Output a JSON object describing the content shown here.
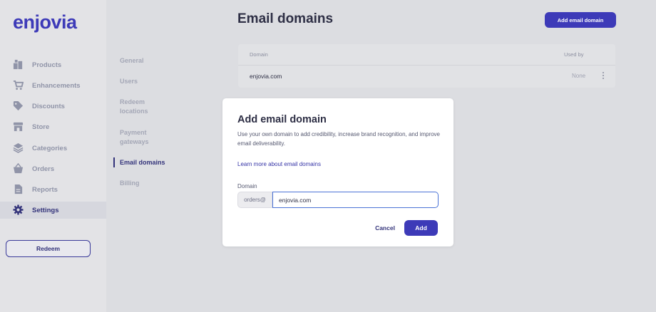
{
  "brand": {
    "name": "enjovia",
    "color": "#3d3ab8"
  },
  "sidebar": {
    "items": [
      {
        "label": "Products",
        "icon": "boxes-icon"
      },
      {
        "label": "Enhancements",
        "icon": "cart-icon"
      },
      {
        "label": "Discounts",
        "icon": "tag-icon"
      },
      {
        "label": "Store",
        "icon": "store-icon"
      },
      {
        "label": "Categories",
        "icon": "layers-icon"
      },
      {
        "label": "Orders",
        "icon": "basket-icon"
      },
      {
        "label": "Reports",
        "icon": "document-icon"
      },
      {
        "label": "Settings",
        "icon": "gear-icon",
        "active": true
      }
    ],
    "redeem_label": "Redeem"
  },
  "subnav": {
    "items": [
      {
        "label": "General"
      },
      {
        "label": "Users"
      },
      {
        "label": "Redeem\nlocations"
      },
      {
        "label": "Payment\ngateways"
      },
      {
        "label": "Email domains",
        "active": true
      },
      {
        "label": "Billing"
      }
    ]
  },
  "page": {
    "title": "Email domains",
    "add_button_label": "Add email domain"
  },
  "table": {
    "columns": [
      "Domain",
      "Used by"
    ],
    "rows": [
      {
        "domain": "enjovia.com",
        "used_by": "None"
      }
    ]
  },
  "modal": {
    "title": "Add email domain",
    "description": "Use your own domain to add credibility, increase brand recognition, and improve email deliverability.",
    "link": "Learn more about email domains",
    "field_label": "Domain",
    "prefix": "orders@",
    "input_value": "enjovia.com",
    "cancel_label": "Cancel",
    "add_label": "Add"
  }
}
